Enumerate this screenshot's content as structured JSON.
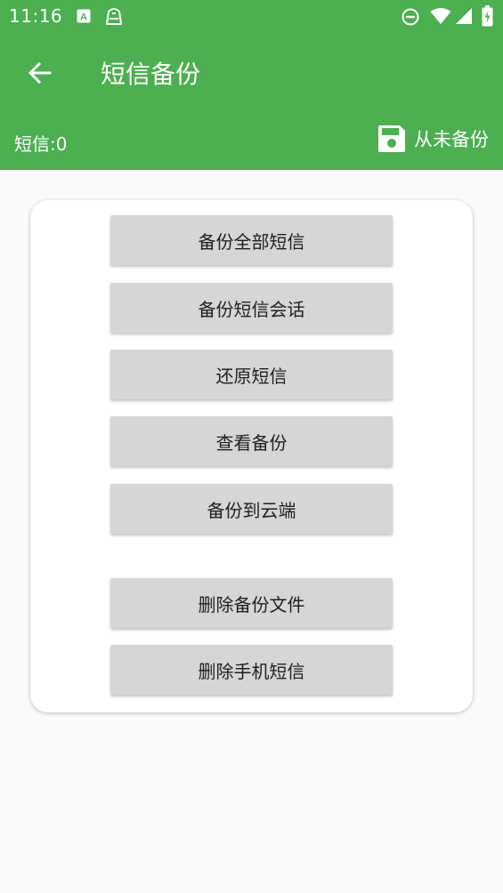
{
  "status_bar": {
    "time": "11:16",
    "icons": [
      "font-a-icon",
      "cleaner-icon",
      "do-not-disturb-icon",
      "wifi-icon",
      "signal-icon",
      "battery-charging-icon"
    ]
  },
  "toolbar": {
    "back_icon": "arrow-left-icon",
    "title": "短信备份"
  },
  "info_bar": {
    "sms_count": "短信:0",
    "backup_icon": "floppy-disk-icon",
    "backup_status": "从未备份"
  },
  "actions": {
    "backup_all": "备份全部短信",
    "backup_conversation": "备份短信会话",
    "restore": "还原短信",
    "view_backup": "查看备份",
    "backup_cloud": "备份到云端",
    "delete_backup_files": "删除备份文件",
    "delete_phone_sms": "删除手机短信"
  },
  "colors": {
    "primary": "#4caf50",
    "button_bg": "#d6d6d6",
    "background": "#fafafa"
  }
}
